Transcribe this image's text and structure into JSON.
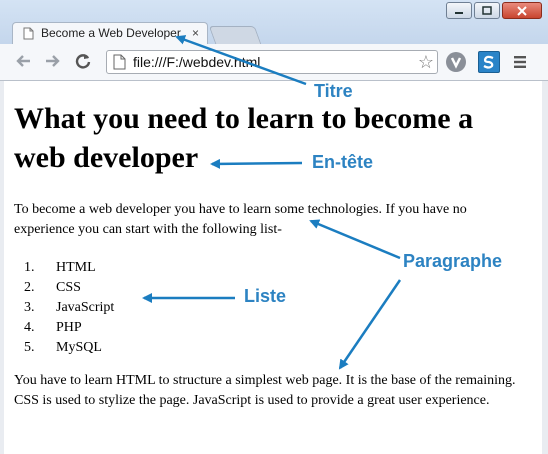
{
  "browser": {
    "tab_title": "Become a Web Developer",
    "tab_close": "×",
    "url": "file:///F:/webdev.html",
    "star": "☆"
  },
  "page": {
    "heading": "What you need to learn to become a web developer",
    "paragraph1": "To become a web developer you have to learn some technologies. If you have no experience you can start with the following list-",
    "list": [
      {
        "num": "1.",
        "text": "HTML"
      },
      {
        "num": "2.",
        "text": "CSS"
      },
      {
        "num": "3.",
        "text": "JavaScript"
      },
      {
        "num": "4.",
        "text": "PHP"
      },
      {
        "num": "5.",
        "text": "MySQL"
      }
    ],
    "paragraph2": "You have to learn HTML to structure a simplest web page. It is the base of the remaining. CSS is used to stylize the page. JavaScript is used to provide a great user experience."
  },
  "annotations": {
    "titre": "Titre",
    "entete": "En-tête",
    "paragraphe": "Paragraphe",
    "liste": "Liste"
  },
  "colors": {
    "annotation": "#2d83c2"
  }
}
